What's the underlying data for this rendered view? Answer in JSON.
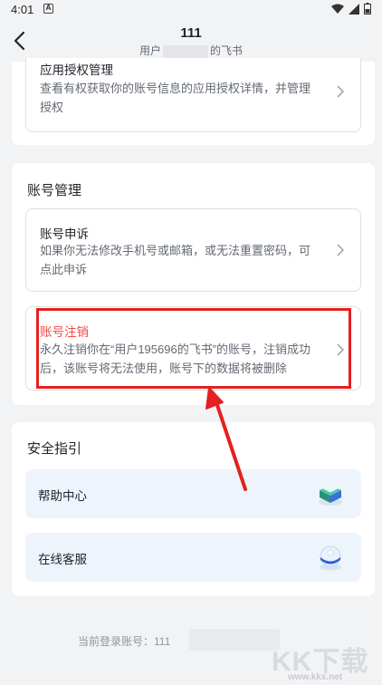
{
  "status": {
    "time": "4:01",
    "a_label": "A"
  },
  "nav": {
    "title": "111",
    "subtitle_left": "用户",
    "subtitle_right": "的飞书"
  },
  "auth_item": {
    "title": "应用授权管理",
    "desc": "查看有权获取你的账号信息的应用授权详情，并管理授权"
  },
  "account_section": {
    "title": "账号管理",
    "appeal": {
      "title": "账号申诉",
      "desc": "如果你无法修改手机号或邮箱，或无法重置密码，可点此申诉"
    },
    "delete": {
      "title": "账号注销",
      "desc": "永久注销你在“用户195696的飞书”的账号，注销成功后，该账号将无法使用，账号下的数据将被删除"
    }
  },
  "safety_section": {
    "title": "安全指引",
    "help_center": "帮助中心",
    "online_service": "在线客服"
  },
  "footer": {
    "current_account": "当前登录账号：111"
  },
  "watermark": {
    "text": "KK下载",
    "url": "www.kkx.net"
  },
  "colors": {
    "danger": "#f54a45",
    "highlight": "#e52020",
    "guide_bg": "#eef4fb"
  }
}
